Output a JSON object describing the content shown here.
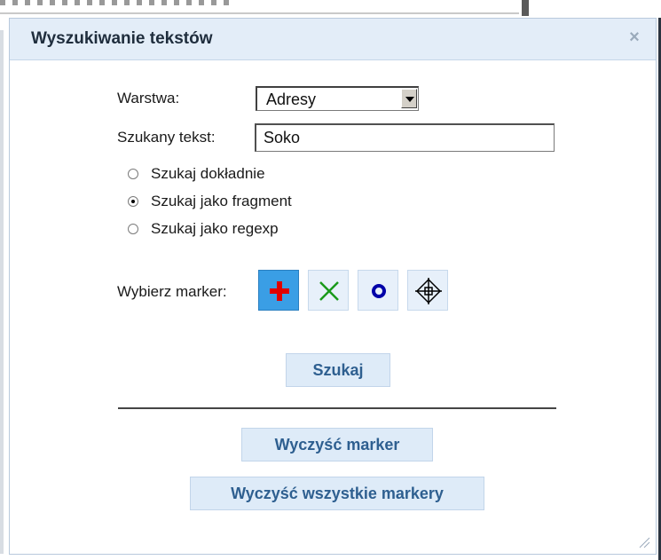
{
  "dialog": {
    "title": "Wyszukiwanie tekstów",
    "close_glyph": "×"
  },
  "form": {
    "layer_label": "Warstwa:",
    "layer_value": "Adresy",
    "search_label": "Szukany tekst:",
    "search_value": "Soko",
    "radio_options": [
      {
        "label": "Szukaj dokładnie",
        "checked": false
      },
      {
        "label": "Szukaj jako fragment",
        "checked": true
      },
      {
        "label": "Szukaj jako regexp",
        "checked": false
      }
    ],
    "marker_label": "Wybierz marker:",
    "markers": [
      {
        "icon": "red-cross-icon",
        "selected": true
      },
      {
        "icon": "green-x-icon",
        "selected": false
      },
      {
        "icon": "blue-circle-icon",
        "selected": false
      },
      {
        "icon": "crosshair-icon",
        "selected": false
      }
    ]
  },
  "buttons": {
    "search": "Szukaj",
    "clear_marker": "Wyczyść marker",
    "clear_all_markers": "Wyczyść wszystkie markery"
  }
}
